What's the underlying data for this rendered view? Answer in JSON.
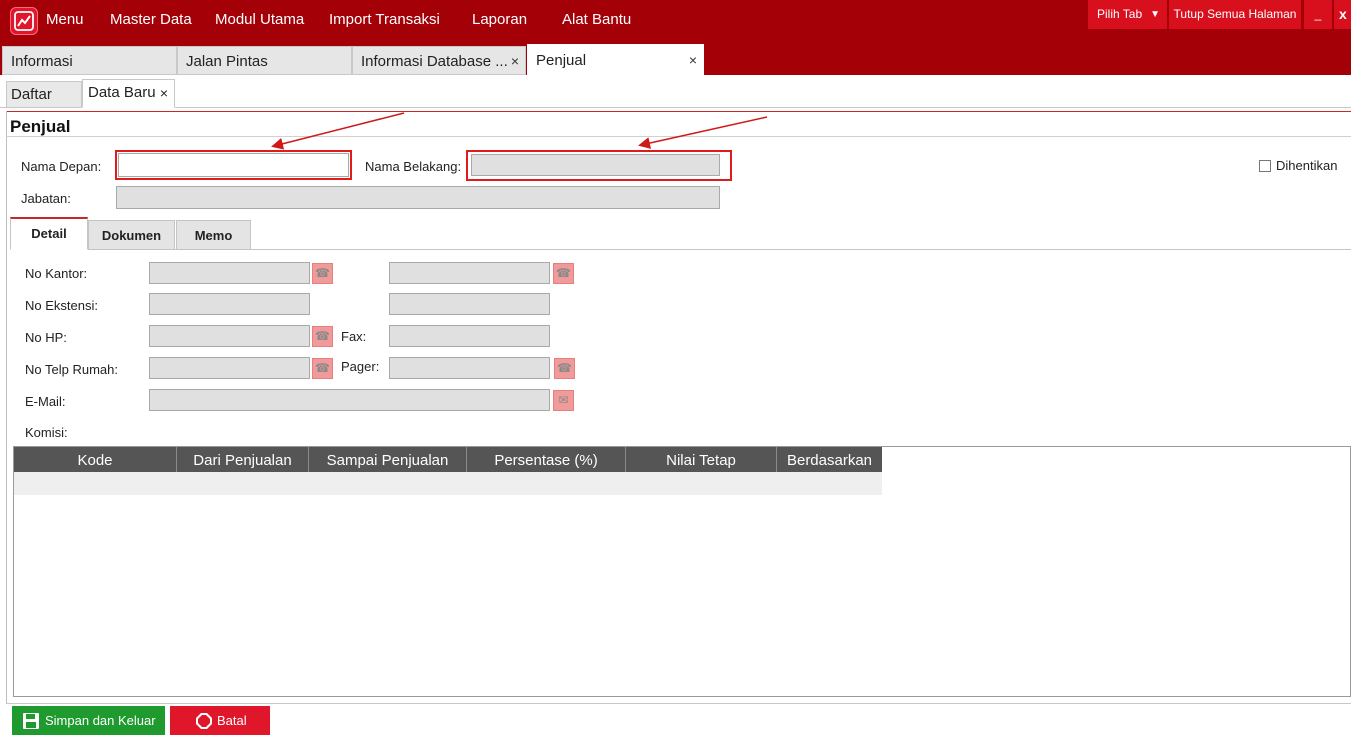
{
  "menubar": {
    "items": [
      "Menu",
      "Master Data",
      "Modul Utama",
      "Import Transaksi",
      "Laporan",
      "Alat Bantu"
    ],
    "pilih_tab": "Pilih Tab",
    "tutup_semua": "Tutup Semua Halaman",
    "minimize": "_",
    "close": "x"
  },
  "tabs": [
    {
      "label": "Informasi",
      "closable": false
    },
    {
      "label": "Jalan Pintas",
      "closable": false
    },
    {
      "label": "Informasi Database ...",
      "closable": true
    },
    {
      "label": "Penjual",
      "closable": true,
      "active": true
    }
  ],
  "tab_close": "×",
  "subtabs": [
    {
      "label": "Daftar"
    },
    {
      "label": "Data Baru",
      "active": true
    }
  ],
  "form": {
    "title": "Penjual",
    "nama_depan_label": "Nama Depan:",
    "nama_depan_value": "",
    "nama_belakang_label": "Nama Belakang:",
    "nama_belakang_value": "",
    "dihentikan_label": "Dihentikan",
    "jabatan_label": "Jabatan:",
    "jabatan_value": ""
  },
  "detail_tabs": [
    "Detail",
    "Dokumen",
    "Memo"
  ],
  "detail": {
    "no_kantor": "No Kantor:",
    "no_ekstensi": "No Ekstensi:",
    "no_hp": "No HP:",
    "fax": "Fax:",
    "no_telp_rumah": "No Telp Rumah:",
    "pager": "Pager:",
    "email": "E-Mail:",
    "komisi": "Komisi:"
  },
  "grid": {
    "columns": [
      "Kode",
      "Dari Penjualan",
      "Sampai Penjualan",
      "Persentase (%)",
      "Nilai Tetap",
      "Berdasarkan"
    ],
    "rows": []
  },
  "buttons": {
    "simpan": "Simpan dan Keluar",
    "batal": "Batal"
  },
  "colors": {
    "brand_red": "#a30008",
    "highlight_red": "#e01b1b",
    "save_green": "#1e9a2e",
    "cancel_red": "#e0162b"
  }
}
